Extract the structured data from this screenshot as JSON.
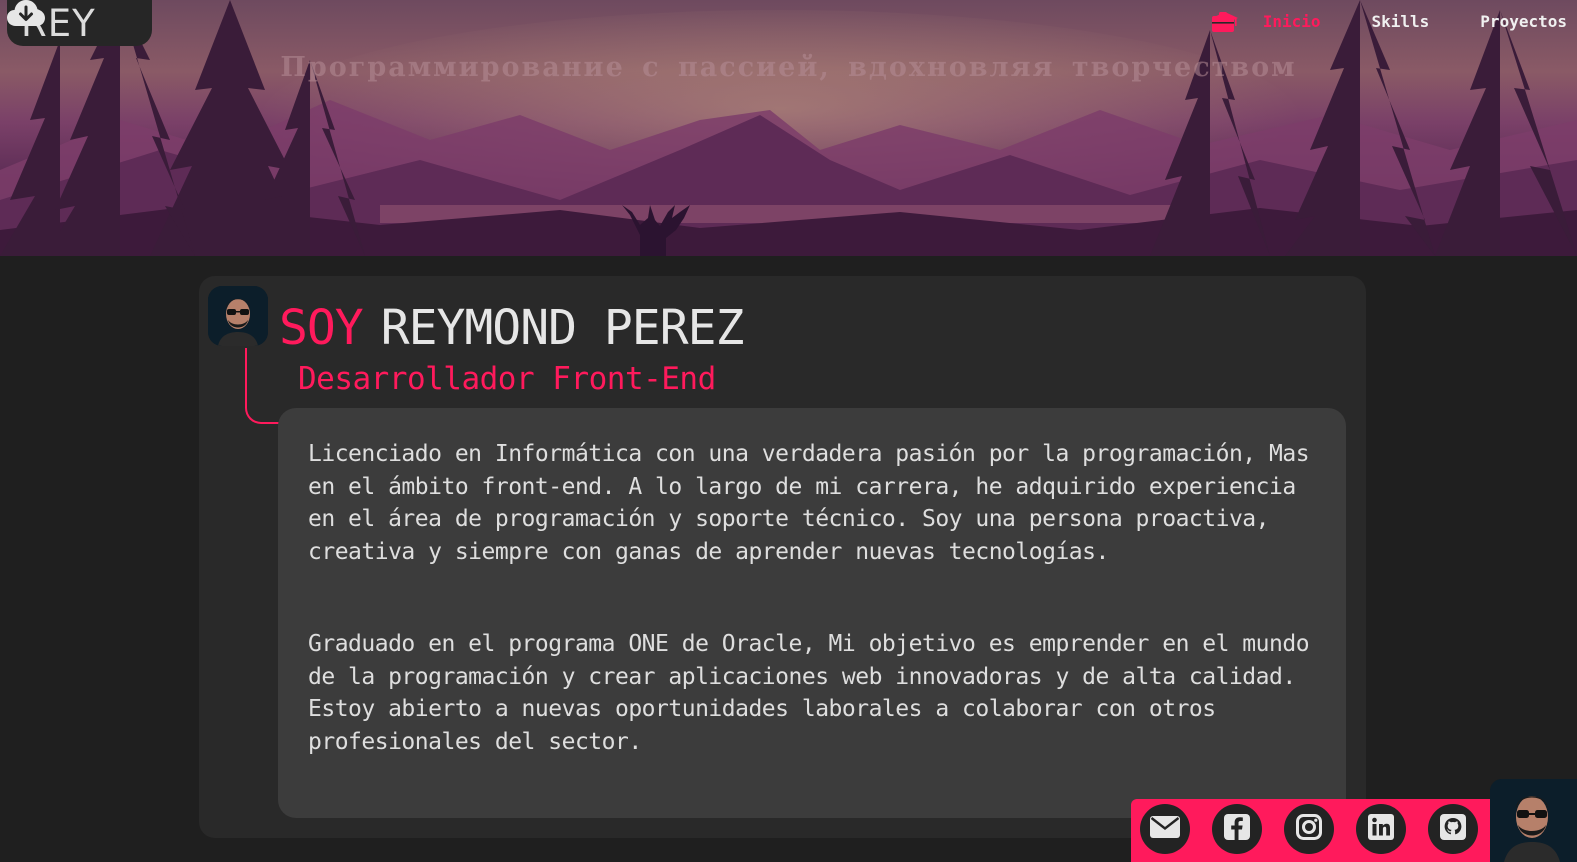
{
  "header": {
    "logo_text": "REY",
    "logo_icon": "cloud-download-icon",
    "tagline": "Программирование с пассией, вдохновляя творчеством",
    "nav": [
      {
        "label": "Inicio",
        "icon": "home-icon",
        "active": true
      },
      {
        "label": "Skills",
        "icon": "graduation-cap-icon",
        "active": false
      },
      {
        "label": "Proyectos",
        "icon": "briefcase-icon",
        "active": false
      }
    ]
  },
  "profile": {
    "prefix": "SOY",
    "name": "REYMOND PEREZ",
    "role": "Desarrollador Front-End",
    "bio": [
      "Licenciado en Informática con una verdadera pasión por la programación, Mas en el ámbito front-end. A lo largo de mi carrera, he adquirido experiencia en el área de programación y soporte técnico. Soy una persona proactiva, creativa y siempre con ganas de aprender nuevas tecnologías.",
      "Graduado en el programa ONE de Oracle, Mi objetivo es emprender en el mundo de la programación y crear aplicaciones web innovadoras y de alta calidad. Estoy abierto a nuevas oportunidades laborales a colaborar con otros profesionales del sector."
    ]
  },
  "social": [
    "envelope-icon",
    "facebook-icon",
    "instagram-icon",
    "linkedin-icon",
    "github-icon"
  ],
  "colors": {
    "accent": "#ff1a5c",
    "background": "#1f1f1f",
    "card": "#292929",
    "bio_box": "#3c3c3c"
  }
}
